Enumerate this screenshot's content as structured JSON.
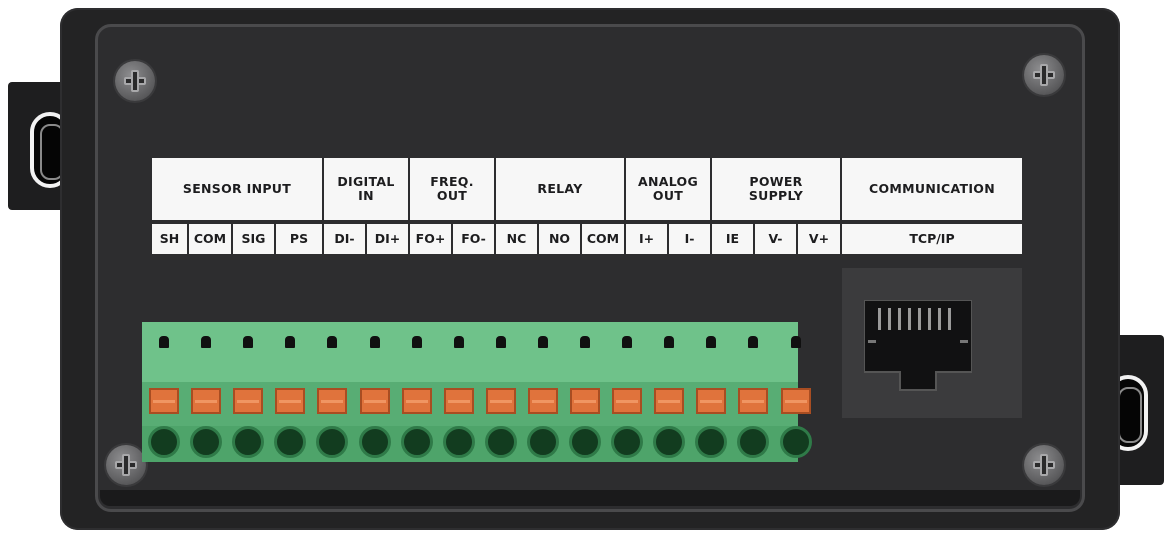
{
  "groups": [
    {
      "label": "SENSOR INPUT"
    },
    {
      "label": "DIGITAL\nIN"
    },
    {
      "label": "FREQ.\nOUT"
    },
    {
      "label": "RELAY"
    },
    {
      "label": "ANALOG\nOUT"
    },
    {
      "label": "POWER\nSUPPLY"
    },
    {
      "label": "COMMUNICATION"
    }
  ],
  "pins": [
    {
      "label": "SH"
    },
    {
      "label": "COM"
    },
    {
      "label": "SIG"
    },
    {
      "label": "PS"
    },
    {
      "label": "DI-"
    },
    {
      "label": "DI+"
    },
    {
      "label": "FO+"
    },
    {
      "label": "FO-"
    },
    {
      "label": "NC"
    },
    {
      "label": "NO"
    },
    {
      "label": "COM"
    },
    {
      "label": "I+"
    },
    {
      "label": "I-"
    },
    {
      "label": "IE"
    },
    {
      "label": "V-"
    },
    {
      "label": "V+"
    },
    {
      "label": "TCP/IP"
    }
  ],
  "terminal_block": {
    "pin_count": 16
  },
  "colors": {
    "housing": "#232324",
    "label_background": "#f7f7f7",
    "label_text": "#1d1d1f",
    "terminal_green": "#6fc28a",
    "release_button_orange": "#e0733c"
  },
  "icons": [
    "screw-icon",
    "mounting-hole-icon",
    "ethernet-port-icon"
  ]
}
